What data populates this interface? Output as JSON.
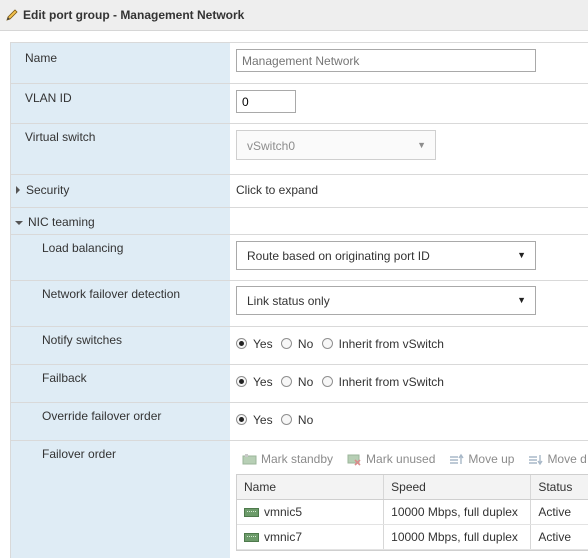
{
  "dialog": {
    "title": "Edit port group - Management Network"
  },
  "fields": {
    "name": {
      "label": "Name",
      "placeholder": "Management Network"
    },
    "vlan": {
      "label": "VLAN ID",
      "value": "0"
    },
    "vswitch": {
      "label": "Virtual switch",
      "value": "vSwitch0"
    },
    "security": {
      "label": "Security",
      "value": "Click to expand"
    },
    "nic_teaming": {
      "label": "NIC teaming"
    },
    "load_balancing": {
      "label": "Load balancing",
      "value": "Route based on originating port ID"
    },
    "failover_detection": {
      "label": "Network failover detection",
      "value": "Link status only"
    },
    "notify_switches": {
      "label": "Notify switches",
      "options": [
        "Yes",
        "No",
        "Inherit from vSwitch"
      ],
      "selected": "Yes"
    },
    "failback": {
      "label": "Failback",
      "options": [
        "Yes",
        "No",
        "Inherit from vSwitch"
      ],
      "selected": "Yes"
    },
    "override_failover": {
      "label": "Override failover order",
      "options": [
        "Yes",
        "No"
      ],
      "selected": "Yes"
    },
    "failover_order": {
      "label": "Failover order",
      "toolbar": {
        "mark_standby": "Mark standby",
        "mark_unused": "Mark unused",
        "move_up": "Move up",
        "move_down": "Move d"
      },
      "columns": [
        "Name",
        "Speed",
        "Status"
      ],
      "rows": [
        {
          "name": "vmnic5",
          "speed": "10000 Mbps, full duplex",
          "status": "Active"
        },
        {
          "name": "vmnic7",
          "speed": "10000 Mbps, full duplex",
          "status": "Active"
        }
      ]
    }
  },
  "colors": {
    "label_column": "#dfecf5",
    "title_bar": "#eeeeee",
    "nic_icon": "#6c9b6a"
  }
}
